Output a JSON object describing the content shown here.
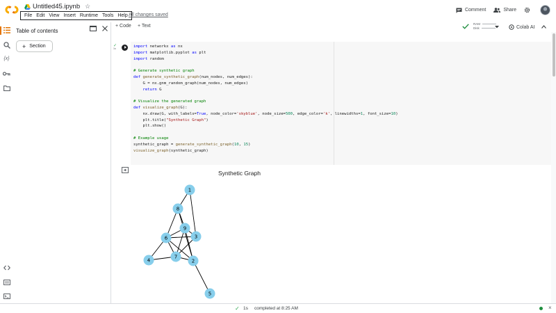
{
  "app": {
    "file_name": "Untitled45.ipynb",
    "menu": [
      "File",
      "Edit",
      "View",
      "Insert",
      "Runtime",
      "Tools",
      "Help"
    ],
    "save_status": "All changes saved",
    "actions": {
      "comment": "Comment",
      "share": "Share"
    }
  },
  "sidebar": {
    "toc_title": "Table of contents",
    "section_button": "Section",
    "rail_icons": [
      "toc-icon",
      "search-icon",
      "variables-icon",
      "secrets-icon",
      "files-icon"
    ],
    "bottom_icons": [
      "code-snippets-icon",
      "command-palette-icon",
      "terminal-icon"
    ]
  },
  "toolbar": {
    "add_code": "+ Code",
    "add_text": "+ Text",
    "ram_label": "RAM",
    "disk_label": "Disk",
    "colab_ai": "Colab AI"
  },
  "cell": {
    "exec_time": "1s",
    "code_lines": [
      "import networkx as nx",
      "import matplotlib.pyplot as plt",
      "import random",
      "",
      "# Generate synthetic graph",
      "def generate_synthetic_graph(num_nodes, num_edges):",
      "    G = nx.gnm_random_graph(num_nodes, num_edges)",
      "    return G",
      "",
      "# Visualize the generated graph",
      "def visualize_graph(G):",
      "    nx.draw(G, with_labels=True, node_color='skyblue', node_size=500, edge_color='k', linewidths=1, font_size=10)",
      "    plt.title(\"Synthetic Graph\")",
      "    plt.show()",
      "",
      "# Example usage",
      "synthetic_graph = generate_synthetic_graph(10, 15)",
      "visualize_graph(synthetic_graph)"
    ]
  },
  "output": {
    "title": "Synthetic Graph",
    "node_color": "#87ceeb",
    "edge_color": "#000000",
    "nodes": [
      "1",
      "8",
      "9",
      "3",
      "6",
      "7",
      "2",
      "4",
      "5"
    ],
    "edges": [
      [
        "1",
        "8"
      ],
      [
        "1",
        "3"
      ],
      [
        "8",
        "9"
      ],
      [
        "8",
        "6"
      ],
      [
        "8",
        "2"
      ],
      [
        "9",
        "3"
      ],
      [
        "9",
        "6"
      ],
      [
        "9",
        "7"
      ],
      [
        "9",
        "2"
      ],
      [
        "6",
        "3"
      ],
      [
        "6",
        "7"
      ],
      [
        "6",
        "2"
      ],
      [
        "3",
        "7"
      ],
      [
        "7",
        "4"
      ],
      [
        "4",
        "6"
      ],
      [
        "2",
        "5"
      ],
      [
        "7",
        "2"
      ]
    ]
  },
  "status": {
    "time": "1s",
    "text": "completed at 8:25 AM"
  }
}
